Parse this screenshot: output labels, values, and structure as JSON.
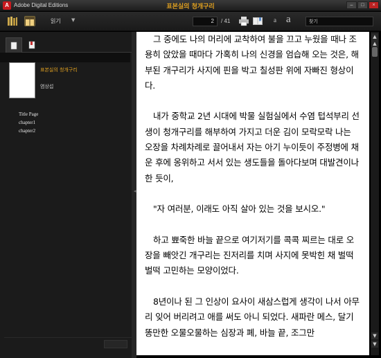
{
  "window": {
    "app_title": "Adobe Digital Editions",
    "doc_title": "표본실의 청개구리",
    "minimize": "–",
    "maximize": "□",
    "close": "×"
  },
  "toolbar": {
    "view_label": "읽기",
    "view_arrow": "▼",
    "current_page": "2",
    "total_pages": "/ 41",
    "font_small": "a",
    "font_large": "a",
    "search_placeholder": "찾기"
  },
  "sidebar": {
    "book_title": "표본실의 청개구리",
    "author": "염상섭",
    "toc": [
      "Title Page",
      "chapter1",
      "chapter2"
    ]
  },
  "content": {
    "paragraphs": [
      "그 중에도 나의 머리에 교착하여 불을 끄고 누웠을 때나 조용히 앉았을 때마다 가혹히 나의 신경을 엄습해 오는 것은, 해부된 개구리가 사지에 핀을 박고 칠성판 위에 자빠진 형상이다.",
      "내가 중학교 2년 시대에 박물 실험실에서 수염 텁석부리 선생이 청개구리를 해부하여 가지고 더운 김이 모락모락 나는 오장을 차례차례로 끌어내서 자는 아기 누이듯이 주정병에 채운 후에 옹위하고 서서 있는 생도들을 돌아다보며 대발견이나 한 듯이,",
      "\"자 여러분, 이래도 아직 살아 있는 것을 보시오.\"",
      "하고 뾰죽한 바늘 끝으로 여기저기를 콕콕 찌르는 대로 오장을 빼앗긴 개구리는 진저리를 치며 사지에 못박힌 채 벌떡벌떡 고민하는 모양이었다.",
      "8년이나 된 그 인상이 요사이 새삼스럽게 생각이 나서 아무리 잊어 버리려고 애를 써도 아니 되었다. 새파란 메스, 달기똥만한 오물오물하는 심장과 폐, 바늘 끝, 조그만"
    ]
  },
  "colors": {
    "accent": "#e0a020",
    "panel": "#1b1b1b",
    "page": "#ffffff"
  }
}
